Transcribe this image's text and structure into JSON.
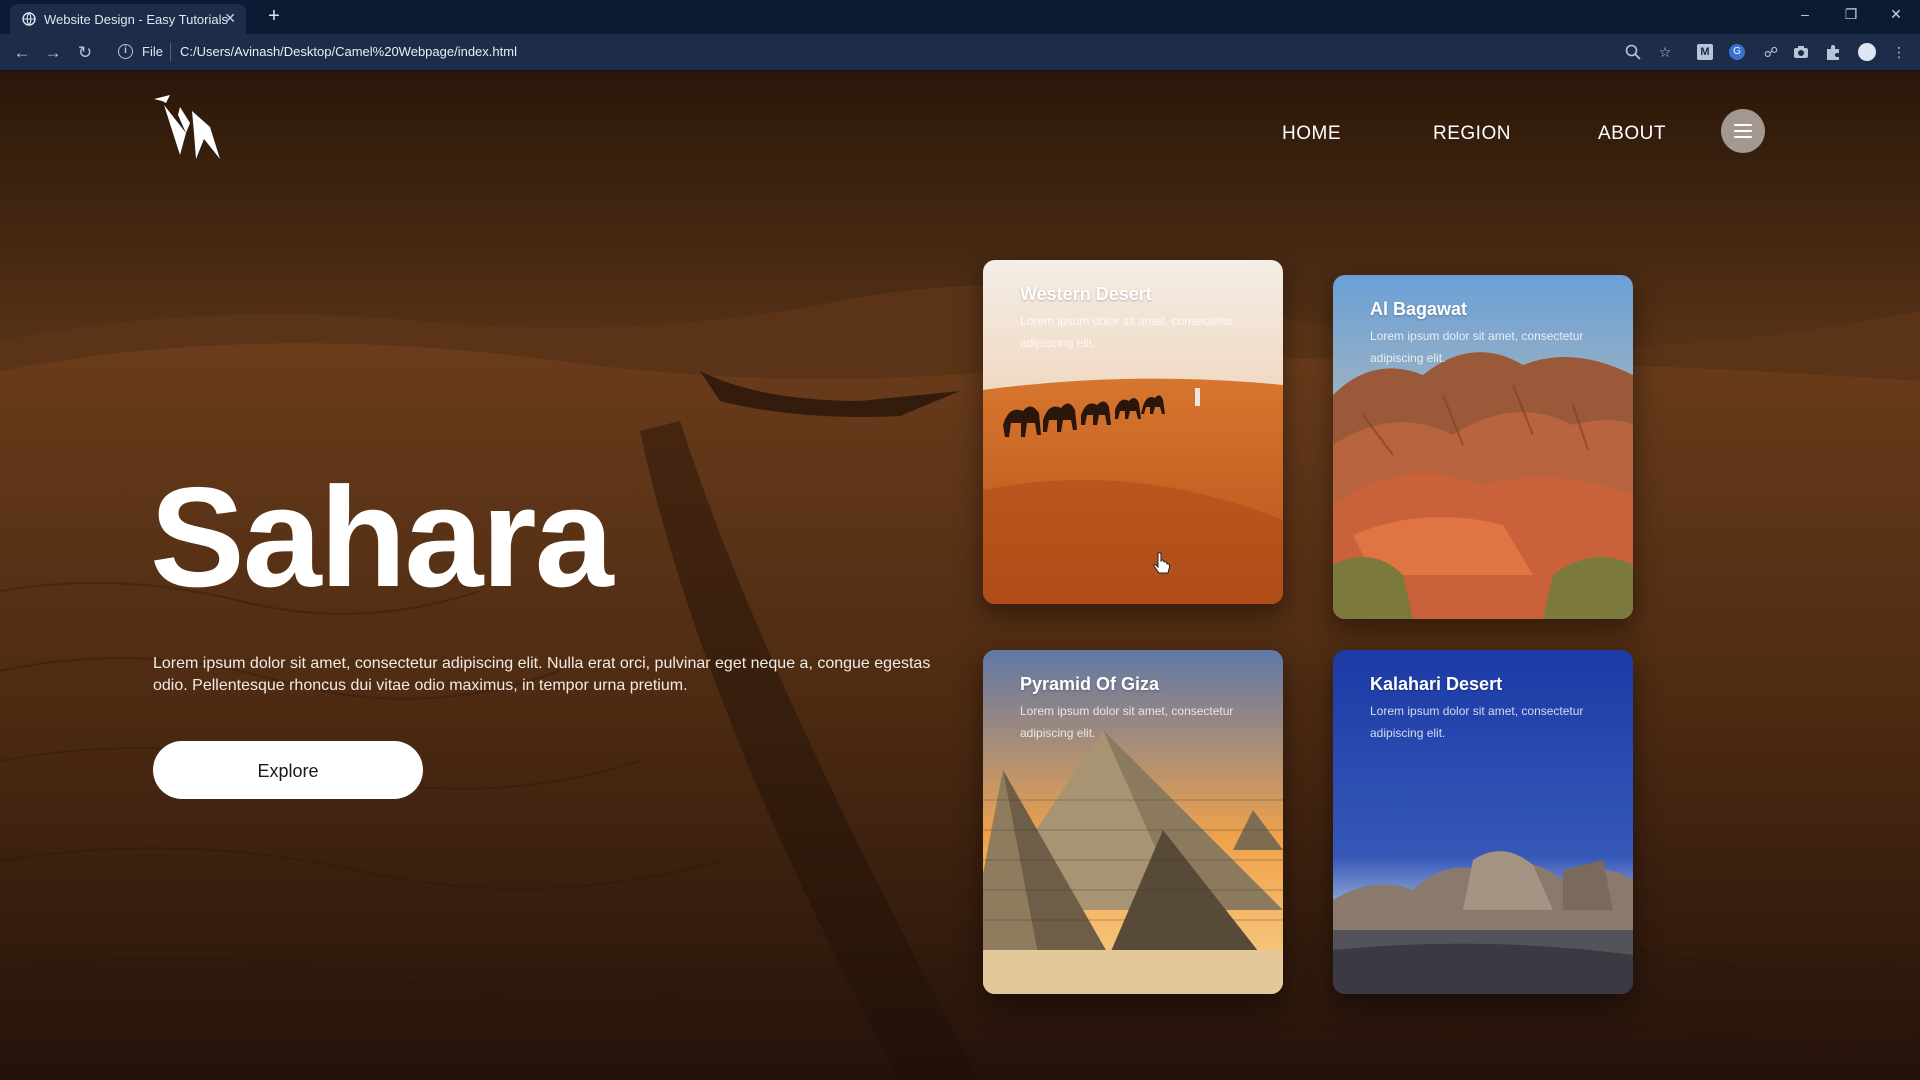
{
  "browser": {
    "tab_title": "Website Design - Easy Tutorials",
    "tab_close": "✕",
    "new_tab": "+",
    "url_scheme": "File",
    "url": "C:/Users/Avinash/Desktop/Camel%20Webpage/index.html",
    "icons": [
      "back-icon",
      "forward-icon",
      "reload-icon",
      "info-icon",
      "zoom-icon",
      "star-icon",
      "extension-m-icon",
      "extension-g-icon",
      "extension-link-icon",
      "camera-icon",
      "puzzle-icon",
      "profile-icon",
      "more-icon"
    ],
    "window_controls": [
      "–",
      "❐",
      "✕"
    ],
    "ext_m": "M",
    "ext_g": "G"
  },
  "nav": {
    "items": [
      "HOME",
      "REGION",
      "ABOUT"
    ]
  },
  "hero": {
    "title": "Sahara",
    "text": "Lorem ipsum dolor sit amet, consectetur adipiscing elit. Nulla erat orci, pulvinar eget neque a, congue egestas odio. Pellentesque rhoncus dui vitae odio maximus, in tempor urna pretium.",
    "button": "Explore"
  },
  "cards": [
    {
      "title": "Western Desert",
      "text": "Lorem ipsum dolor sit amet, consectetur adipiscing elit."
    },
    {
      "title": "Al Bagawat",
      "text": "Lorem ipsum dolor sit amet, consectetur adipiscing elit."
    },
    {
      "title": "Pyramid Of Giza",
      "text": "Lorem ipsum dolor sit amet, consectetur adipiscing elit."
    },
    {
      "title": "Kalahari Desert",
      "text": "Lorem ipsum dolor sit amet, consectetur adipiscing elit."
    }
  ],
  "colors": {
    "browser_bg": "#0c1a33",
    "toolbar_bg": "#1d2c49",
    "sand": "#c8692a",
    "text": "#ffffff"
  }
}
